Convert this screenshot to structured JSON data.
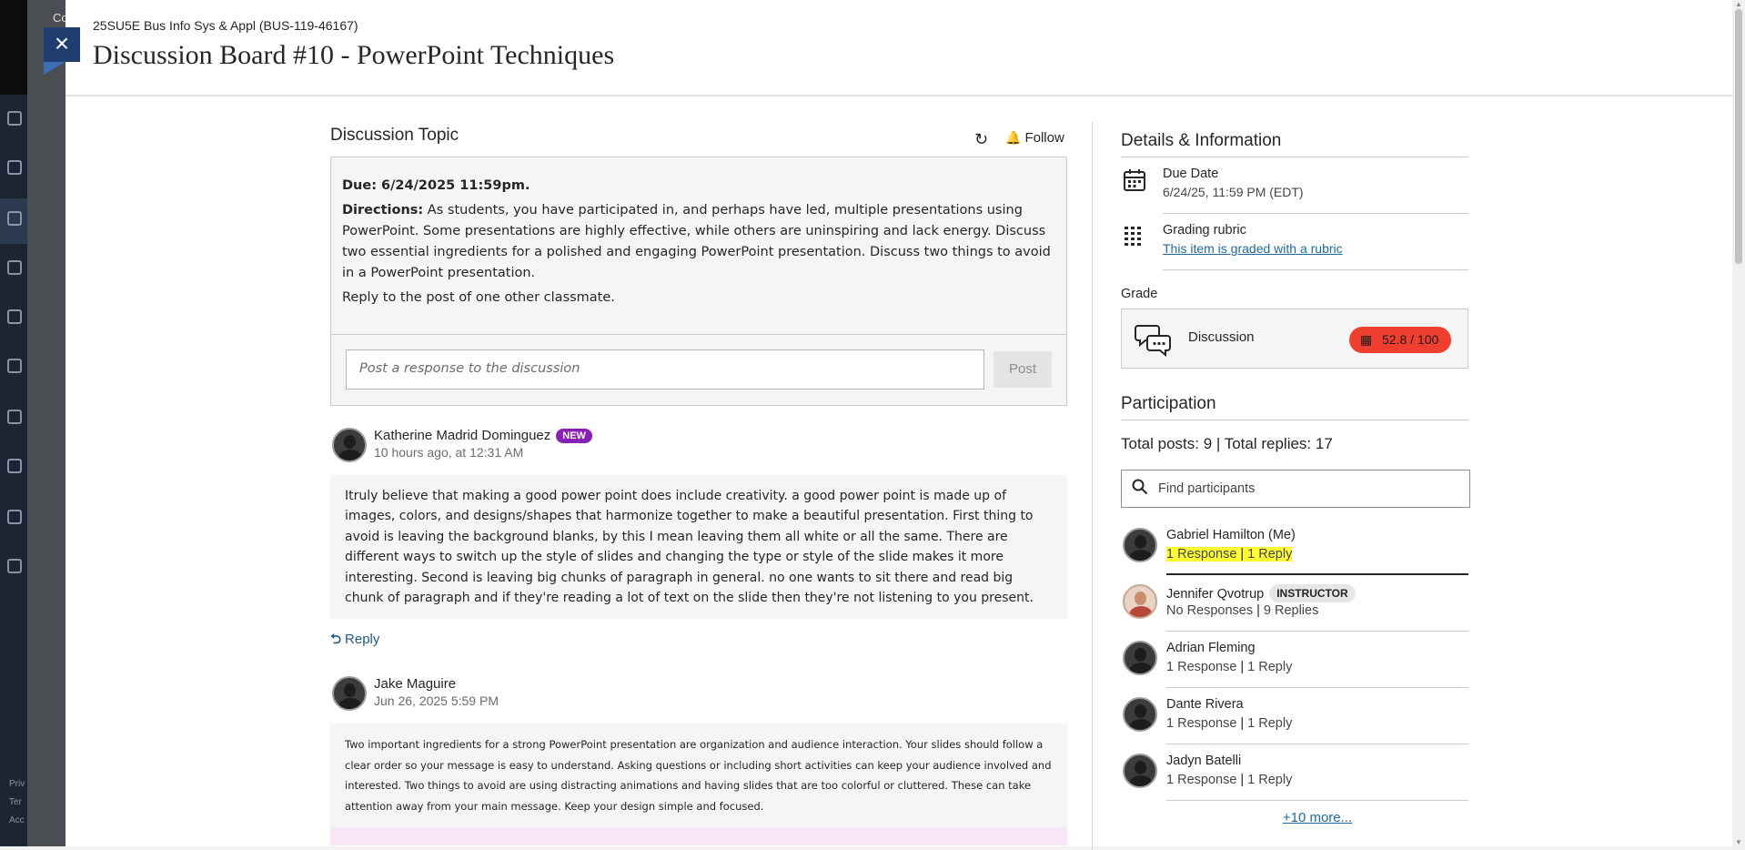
{
  "background": {
    "strip_text": "Co",
    "footer_lines": [
      "Priv",
      "Ter",
      "Acc"
    ]
  },
  "header": {
    "course_name": "25SU5E Bus Info Sys & Appl (BUS-119-46167)",
    "title": "Discussion Board #10 - PowerPoint Techniques",
    "close_glyph": "×"
  },
  "topic": {
    "heading": "Discussion Topic",
    "refresh_icon": "↻",
    "follow_label": "Follow",
    "bell_icon": "🔔",
    "due": "Due: 6/24/2025 11:59pm.",
    "directions_label": "Directions:",
    "directions_text": " As students, you have participated in, and perhaps have led, multiple presentations using PowerPoint. Some presentations are highly effective, while others are uninspiring and lack energy. Discuss two essential ingredients for a polished and engaging PowerPoint presentation. Discuss two things to avoid in a PowerPoint presentation.",
    "reply_instruction": "Reply to the post of one other classmate.",
    "post_placeholder": "Post a response to the discussion",
    "post_button": "Post"
  },
  "replies": [
    {
      "author": "Katherine Madrid Dominguez",
      "badge": "NEW",
      "time": "10 hours ago, at 12:31 AM",
      "body": "Itruly believe that making a good power point does include creativity. a good power point is made up of images, colors, and designs/shapes that harmonize together to make a beautiful presentation. First thing to avoid is leaving the background blanks, by this I mean leaving them all white or all the same. There are different ways to switch up the style of slides and changing the type or style of the slide makes it more interesting. Second is leaving big chunks of paragraph in general. no one wants to sit there and read big chunk of paragraph and if they're reading a lot of text on the slide then they're not listening to you present.",
      "reply_label": "Reply",
      "reply_icon": "⮌"
    },
    {
      "author": "Jake Maguire",
      "time": "Jun 26, 2025 5:59 PM",
      "body": "Two important ingredients for a strong PowerPoint presentation are organization and audience interaction. Your slides should follow a clear order so your message is easy to understand. Asking questions or including short activities can keep your audience involved and interested. Two things to avoid are using distracting animations and having slides that are too colorful or cluttered. These can take attention away from your main message. Keep your design simple and focused."
    }
  ],
  "details": {
    "heading": "Details & Information",
    "due_label": "Due Date",
    "due_value": "6/24/25, 11:59 PM (EDT)",
    "due_icon": "calendar-icon",
    "rubric_label": "Grading rubric",
    "rubric_link": "This item is graded with a rubric",
    "rubric_icon": "rubric-icon",
    "grade_label": "Grade",
    "grade_item": "Discussion",
    "grade_value": "52.8 / 100",
    "grade_color": "#f03e2f"
  },
  "participation": {
    "heading": "Participation",
    "totals": "Total posts: 9 | Total replies: 17",
    "search_placeholder": "Find participants",
    "participants": [
      {
        "name": "Gabriel Hamilton (Me)",
        "responses": "1 Response",
        "replies": "1 Reply"
      },
      {
        "name": "Jennifer Qvotrup",
        "badge": "INSTRUCTOR",
        "responses": "No Responses",
        "replies": "9 Replies"
      },
      {
        "name": "Adrian Fleming",
        "responses": "1 Response",
        "replies": "1 Reply"
      },
      {
        "name": "Dante Rivera",
        "responses": "1 Response",
        "replies": "1 Reply"
      },
      {
        "name": "Jadyn Batelli",
        "responses": "1 Response",
        "replies": "1 Reply"
      }
    ],
    "more_link": "+10 more..."
  }
}
